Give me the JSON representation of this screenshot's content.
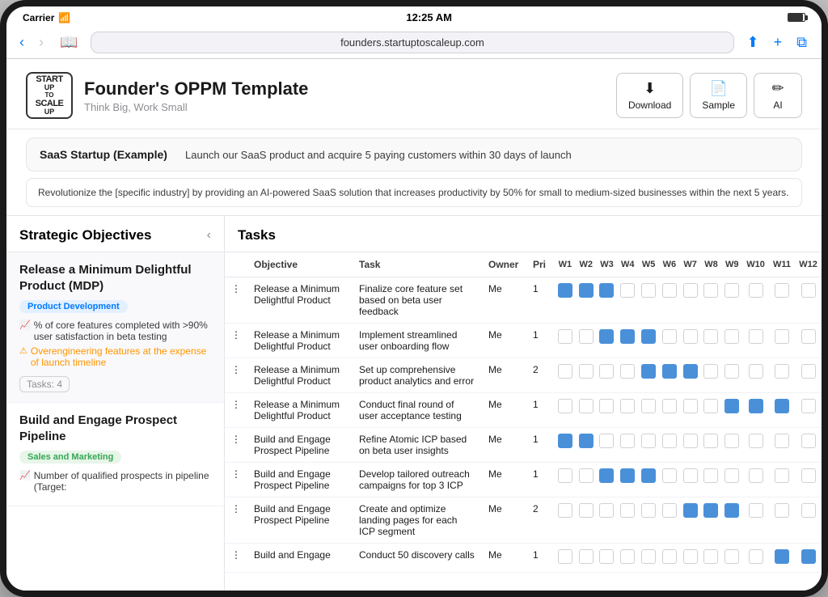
{
  "device": {
    "status_bar": {
      "carrier": "Carrier",
      "time": "12:25 AM",
      "battery_level": 90
    },
    "browser": {
      "url": "founders.startuptoscaleup.com",
      "back_enabled": true,
      "forward_enabled": true
    }
  },
  "header": {
    "logo_line1": "START",
    "logo_line2": "UP",
    "logo_line3": "TO",
    "logo_line4": "SCALE",
    "logo_line5": "UP",
    "title": "Founder's OPPM Template",
    "subtitle": "Think Big, Work Small",
    "buttons": [
      {
        "id": "download",
        "icon": "⬇",
        "label": "Download"
      },
      {
        "id": "sample",
        "icon": "📄",
        "label": "Sample"
      },
      {
        "id": "ai",
        "icon": "✏",
        "label": "AI"
      }
    ]
  },
  "mission": {
    "label": "SaaS Startup (Example)",
    "text": "Launch our SaaS product and acquire 5 paying customers within 30 days of launch"
  },
  "vision": "Revolutionize the [specific industry] by providing an AI-powered SaaS solution that increases productivity by 50% for small to medium-sized businesses within the next 5 years.",
  "sidebar": {
    "title": "Strategic Objectives",
    "objectives": [
      {
        "id": "obj1",
        "title": "Release a Minimum Delightful Product (MDP)",
        "badge": "Product Development",
        "badge_type": "product",
        "metric": "% of core features completed with >90% user satisfaction in beta testing",
        "warning": "Overengineering features at the expense of launch timeline",
        "tasks_count": "Tasks: 4",
        "active": true
      },
      {
        "id": "obj2",
        "title": "Build and Engage Prospect Pipeline",
        "badge": "Sales and Marketing",
        "badge_type": "sales",
        "metric": "Number of qualified prospects in pipeline (Target:",
        "warning": null,
        "tasks_count": null,
        "active": false
      }
    ]
  },
  "tasks": {
    "title": "Tasks",
    "columns": {
      "objective": "Objective",
      "task": "Task",
      "owner": "Owner",
      "pri": "Pri",
      "weeks": [
        "W1",
        "W2",
        "W3",
        "W4",
        "W5",
        "W6",
        "W7",
        "W8",
        "W9",
        "W10",
        "W11",
        "W12"
      ]
    },
    "rows": [
      {
        "objective": "Release a Minimum Delightful Product",
        "task": "Finalize core feature set based on beta user feedback",
        "owner": "Me",
        "pri": "1",
        "weeks": [
          1,
          1,
          1,
          0,
          0,
          0,
          0,
          0,
          0,
          0,
          0,
          0
        ]
      },
      {
        "objective": "Release a Minimum Delightful Product",
        "task": "Implement streamlined user onboarding flow",
        "owner": "Me",
        "pri": "1",
        "weeks": [
          0,
          0,
          1,
          1,
          1,
          0,
          0,
          0,
          0,
          0,
          0,
          0
        ]
      },
      {
        "objective": "Release a Minimum Delightful Product",
        "task": "Set up comprehensive product analytics and error",
        "owner": "Me",
        "pri": "2",
        "weeks": [
          0,
          0,
          0,
          0,
          1,
          1,
          1,
          0,
          0,
          0,
          0,
          0
        ]
      },
      {
        "objective": "Release a Minimum Delightful Product",
        "task": "Conduct final round of user acceptance testing",
        "owner": "Me",
        "pri": "1",
        "weeks": [
          0,
          0,
          0,
          0,
          0,
          0,
          0,
          0,
          1,
          1,
          1,
          0
        ]
      },
      {
        "objective": "Build and Engage Prospect Pipeline",
        "task": "Refine Atomic ICP based on beta user insights",
        "owner": "Me",
        "pri": "1",
        "weeks": [
          1,
          1,
          0,
          0,
          0,
          0,
          0,
          0,
          0,
          0,
          0,
          0
        ]
      },
      {
        "objective": "Build and Engage Prospect Pipeline",
        "task": "Develop tailored outreach campaigns for top 3 ICP",
        "owner": "Me",
        "pri": "1",
        "weeks": [
          0,
          0,
          1,
          1,
          1,
          0,
          0,
          0,
          0,
          0,
          0,
          0
        ]
      },
      {
        "objective": "Build and Engage Prospect Pipeline",
        "task": "Create and optimize landing pages for each ICP segment",
        "owner": "Me",
        "pri": "2",
        "weeks": [
          0,
          0,
          0,
          0,
          0,
          0,
          1,
          1,
          1,
          0,
          0,
          0
        ]
      },
      {
        "objective": "Build and Engage",
        "task": "Conduct 50 discovery calls",
        "owner": "Me",
        "pri": "1",
        "weeks": [
          0,
          0,
          0,
          0,
          0,
          0,
          0,
          0,
          0,
          0,
          1,
          1
        ]
      }
    ]
  }
}
